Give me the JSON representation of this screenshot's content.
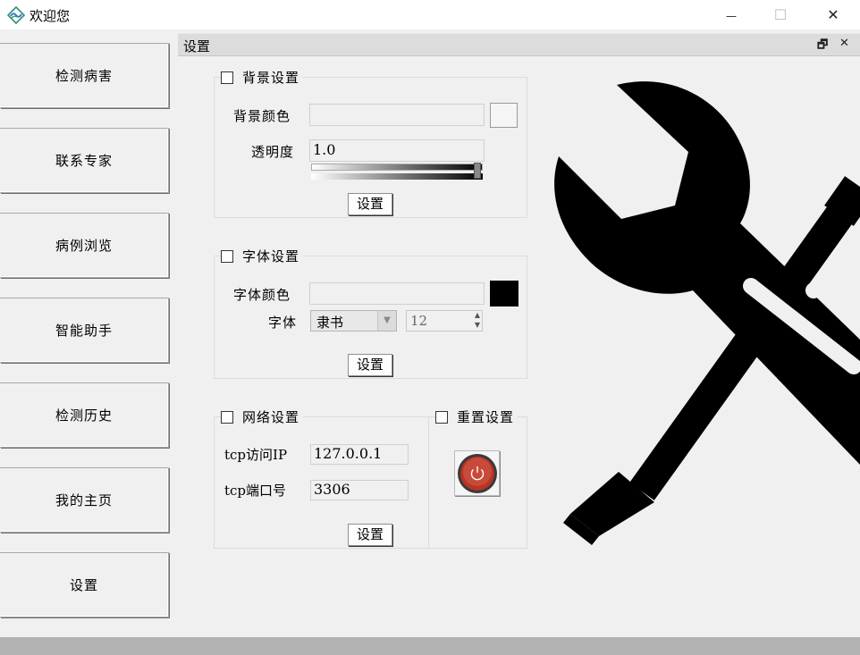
{
  "window": {
    "title": "欢迎您",
    "minimize_icon": "—",
    "maximize_icon": "☐",
    "close_icon": "✕"
  },
  "sidebar": {
    "items": [
      {
        "label": "检测病害"
      },
      {
        "label": "联系专家"
      },
      {
        "label": "病例浏览"
      },
      {
        "label": "智能助手"
      },
      {
        "label": "检测历史"
      },
      {
        "label": "我的主页"
      },
      {
        "label": "设置"
      }
    ]
  },
  "panel": {
    "title": "设置",
    "restore_icon": "🗗",
    "close_icon": "✕"
  },
  "background_settings": {
    "group_title": "背景设置",
    "checked": false,
    "color_label": "背景颜色",
    "color_value": "",
    "opacity_label": "透明度",
    "opacity_value": "1.0",
    "slider_fraction": 1.0,
    "set_button": "设置"
  },
  "font_settings": {
    "group_title": "字体设置",
    "checked": false,
    "color_label": "字体颜色",
    "color_value": "",
    "swatch_color": "#000000",
    "font_label": "字体",
    "font_value": "隶书",
    "size_value": "12",
    "set_button": "设置"
  },
  "network_settings": {
    "group_title": "网络设置",
    "checked": false,
    "ip_label": "tcp访问IP",
    "ip_value": "127.0.0.1",
    "port_label": "tcp端口号",
    "port_value": "3306",
    "set_button": "设置"
  },
  "reset_settings": {
    "group_title": "重置设置",
    "checked": false,
    "power_icon": "power-icon",
    "button_color": "#c0392b"
  },
  "decoration": {
    "icon": "tools-icon"
  }
}
